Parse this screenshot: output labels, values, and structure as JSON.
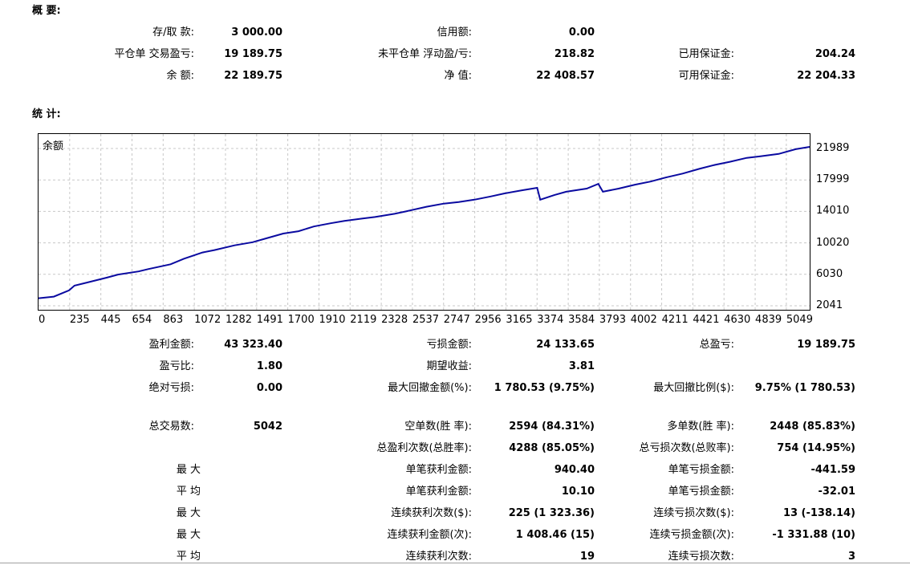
{
  "sections": {
    "summary": "概 要:",
    "stats": "统 计:"
  },
  "summary": {
    "deposit_label": "存/取 款:",
    "deposit_value": "3 000.00",
    "credit_label": "信用额:",
    "credit_value": "0.00",
    "closed_pl_label": "平仓单 交易盈亏:",
    "closed_pl_value": "19 189.75",
    "floating_pl_label": "未平仓单 浮动盈/亏:",
    "floating_pl_value": "218.82",
    "margin_label": "已用保证金:",
    "margin_value": "204.24",
    "balance_label": "余 额:",
    "balance_value": "22 189.75",
    "equity_label": "净 值:",
    "equity_value": "22 408.57",
    "free_margin_label": "可用保证金:",
    "free_margin_value": "22 204.33"
  },
  "stats": {
    "gross_profit_label": "盈利金额:",
    "gross_profit_value": "43 323.40",
    "gross_loss_label": "亏损金额:",
    "gross_loss_value": "24 133.65",
    "total_pl_label": "总盈亏:",
    "total_pl_value": "19 189.75",
    "profit_factor_label": "盈亏比:",
    "profit_factor_value": "1.80",
    "expected_label": "期望收益:",
    "expected_value": "3.81",
    "abs_dd_label": "绝对亏损:",
    "abs_dd_value": "0.00",
    "max_dd_label": "最大回撤金额(%):",
    "max_dd_value": "1 780.53 (9.75%)",
    "rel_dd_label": "最大回撤比例($):",
    "rel_dd_value": "9.75% (1 780.53)",
    "total_trades_label": "总交易数:",
    "total_trades_value": "5042",
    "short_label": "空单数(胜 率):",
    "short_value": "2594 (84.31%)",
    "long_label": "多单数(胜 率):",
    "long_value": "2448 (85.83%)",
    "win_trades_label": "总盈利次数(总胜率):",
    "win_trades_value": "4288 (85.05%)",
    "loss_trades_label": "总亏损次数(总败率):",
    "loss_trades_value": "754 (14.95%)",
    "rows": [
      {
        "left": "最 大",
        "a_label": "单笔获利金额:",
        "a_value": "940.40",
        "b_label": "单笔亏损金额:",
        "b_value": "-441.59"
      },
      {
        "left": "平 均",
        "a_label": "单笔获利金额:",
        "a_value": "10.10",
        "b_label": "单笔亏损金额:",
        "b_value": "-32.01"
      },
      {
        "left": "最 大",
        "a_label": "连续获利次数($):",
        "a_value": "225 (1 323.36)",
        "b_label": "连续亏损次数($):",
        "b_value": "13 (-138.14)"
      },
      {
        "left": "最 大",
        "a_label": "连续获利金额(次):",
        "a_value": "1 408.46 (15)",
        "b_label": "连续亏损金额(次):",
        "b_value": "-1 331.88 (10)"
      },
      {
        "left": "平 均",
        "a_label": "连续获利次数:",
        "a_value": "19",
        "b_label": "连续亏损次数:",
        "b_value": "3"
      }
    ]
  },
  "chart_data": {
    "type": "line",
    "title": "余额",
    "line_color": "#0a0aa0",
    "grid": true,
    "xlim": [
      0,
      5042
    ],
    "ylim": [
      2041,
      22408
    ],
    "x_ticks": [
      "0",
      "235",
      "445",
      "654",
      "863",
      "1072",
      "1282",
      "1491",
      "1700",
      "1910",
      "2119",
      "2328",
      "2537",
      "2747",
      "2956",
      "3165",
      "3374",
      "3584",
      "3793",
      "4002",
      "4211",
      "4421",
      "4630",
      "4839",
      "5049"
    ],
    "y_ticks": [
      "21989",
      "17999",
      "14010",
      "10020",
      "6030",
      "2041"
    ],
    "series": [
      {
        "x": [
          0,
          100,
          200,
          235,
          300,
          445,
          520,
          654,
          720,
          863,
          950,
          1072,
          1150,
          1282,
          1400,
          1491,
          1600,
          1700,
          1800,
          1910,
          2000,
          2119,
          2200,
          2328,
          2400,
          2537,
          2650,
          2747,
          2850,
          2956,
          3050,
          3165,
          3260,
          3280,
          3374,
          3450,
          3584,
          3660,
          3690,
          3793,
          3900,
          4002,
          4100,
          4211,
          4320,
          4421,
          4520,
          4630,
          4720,
          4839,
          4950,
          5042
        ],
        "y": [
          3000,
          3200,
          4000,
          4600,
          4900,
          5600,
          6000,
          6400,
          6700,
          7300,
          8000,
          8800,
          9100,
          9700,
          10100,
          10600,
          11200,
          11500,
          12100,
          12500,
          12800,
          13100,
          13300,
          13700,
          14000,
          14600,
          15000,
          15200,
          15500,
          15900,
          16300,
          16700,
          17000,
          15500,
          16100,
          16500,
          16900,
          17500,
          16500,
          16900,
          17400,
          17800,
          18300,
          18800,
          19400,
          19900,
          20300,
          20800,
          21000,
          21300,
          21900,
          22190
        ]
      }
    ]
  }
}
